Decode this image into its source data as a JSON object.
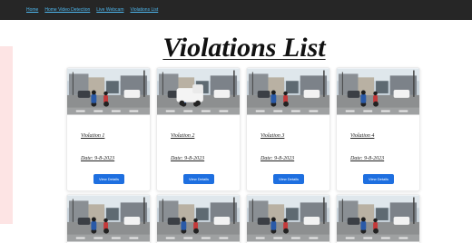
{
  "nav": {
    "links": [
      "Home",
      "Home Video Detection",
      "Live Webcam",
      "Violations List"
    ]
  },
  "page": {
    "title": "Violations List"
  },
  "violations": [
    {
      "title": "Violation 1",
      "date": "Date: 9-8-2023",
      "button": "View Details"
    },
    {
      "title": "Violation 2",
      "date": "Date: 9-8-2023",
      "button": "View Details"
    },
    {
      "title": "Violation 3",
      "date": "Date: 9-8-2023",
      "button": "View Details"
    },
    {
      "title": "Violation 4",
      "date": "Date: 9-8-2023",
      "button": "View Details"
    }
  ],
  "colors": {
    "navbar": "#262626",
    "nav_link": "#4fb8ef",
    "button": "#1e6fe0",
    "left_accent": "#fde4e4"
  }
}
